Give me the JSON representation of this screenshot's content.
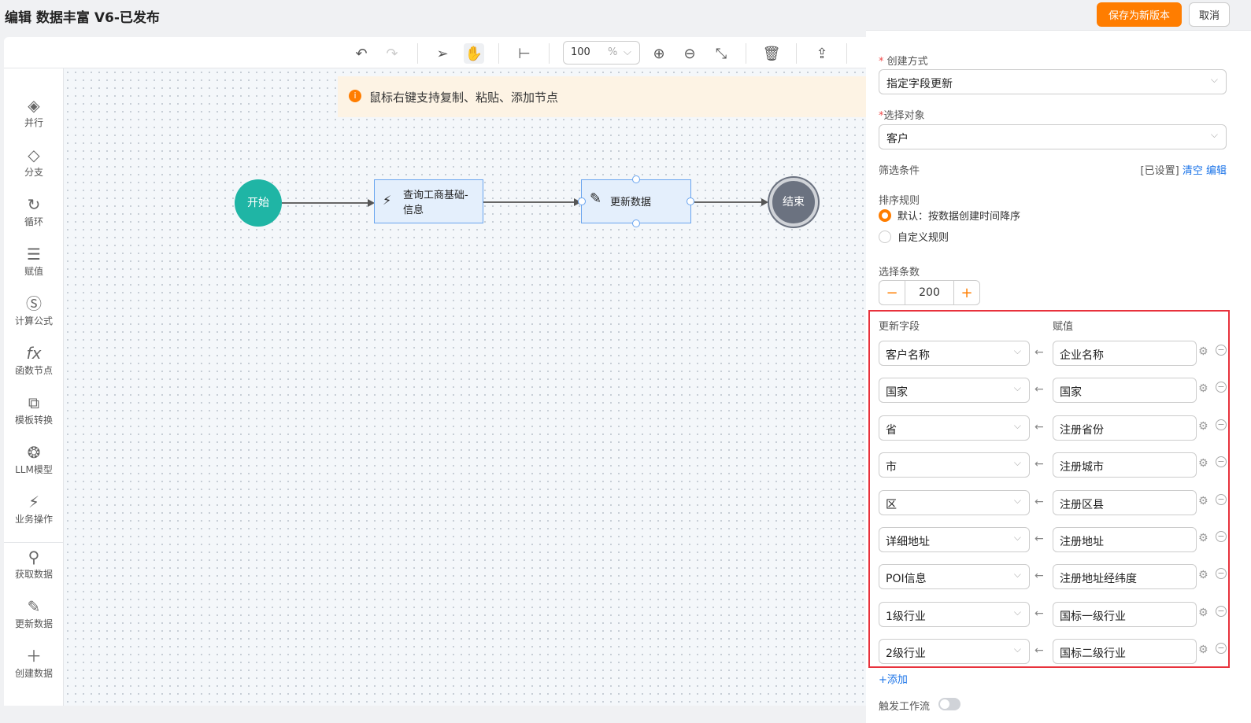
{
  "header": {
    "title": "编辑 数据丰富 V6-已发布",
    "save_label": "保存为新版本",
    "cancel_label": "取消"
  },
  "toolbar": {
    "zoom_value": "100",
    "zoom_unit": "%"
  },
  "sidebar": {
    "items": [
      {
        "label": "并行",
        "icon": "parallel-icon"
      },
      {
        "label": "分支",
        "icon": "branch-icon"
      },
      {
        "label": "循环",
        "icon": "loop-icon"
      },
      {
        "label": "赋值",
        "icon": "assign-icon"
      },
      {
        "label": "计算公式",
        "icon": "sigma-icon"
      },
      {
        "label": "函数节点",
        "icon": "fx-icon"
      },
      {
        "label": "模板转换",
        "icon": "template-icon"
      },
      {
        "label": "LLM模型",
        "icon": "llm-icon"
      },
      {
        "label": "业务操作",
        "icon": "business-icon"
      },
      {
        "label": "获取数据",
        "icon": "search-icon"
      },
      {
        "label": "更新数据",
        "icon": "pencil-icon"
      },
      {
        "label": "创建数据",
        "icon": "plus-icon"
      }
    ]
  },
  "canvas": {
    "notice": "鼠标右键支持复制、粘贴、添加节点",
    "nodes": {
      "start": "开始",
      "query": "查询工商基础-信息",
      "update": "更新数据",
      "end": "结束"
    }
  },
  "panel": {
    "create_mode_label": "创建方式",
    "create_mode_value": "指定字段更新",
    "object_label": "选择对象",
    "object_value": "客户",
    "filter_label": "筛选条件",
    "filter_status": "[已设置]",
    "filter_clear": "清空",
    "filter_edit": "编辑",
    "sort_label": "排序规则",
    "sort_options": [
      "默认：按数据创建时间降序",
      "自定义规则"
    ],
    "count_label": "选择条数",
    "count_value": "200",
    "field_header": "更新字段",
    "value_header": "赋值",
    "mappings": [
      {
        "field": "客户名称",
        "value": "企业名称"
      },
      {
        "field": "国家",
        "value": "国家"
      },
      {
        "field": "省",
        "value": "注册省份"
      },
      {
        "field": "市",
        "value": "注册城市"
      },
      {
        "field": "区",
        "value": "注册区县"
      },
      {
        "field": "详细地址",
        "value": "注册地址"
      },
      {
        "field": "POI信息",
        "value": "注册地址经纬度"
      },
      {
        "field": "1级行业",
        "value": "国标一级行业"
      },
      {
        "field": "2级行业",
        "value": "国标二级行业"
      }
    ],
    "add_label": "+添加",
    "trigger_label": "触发工作流"
  }
}
